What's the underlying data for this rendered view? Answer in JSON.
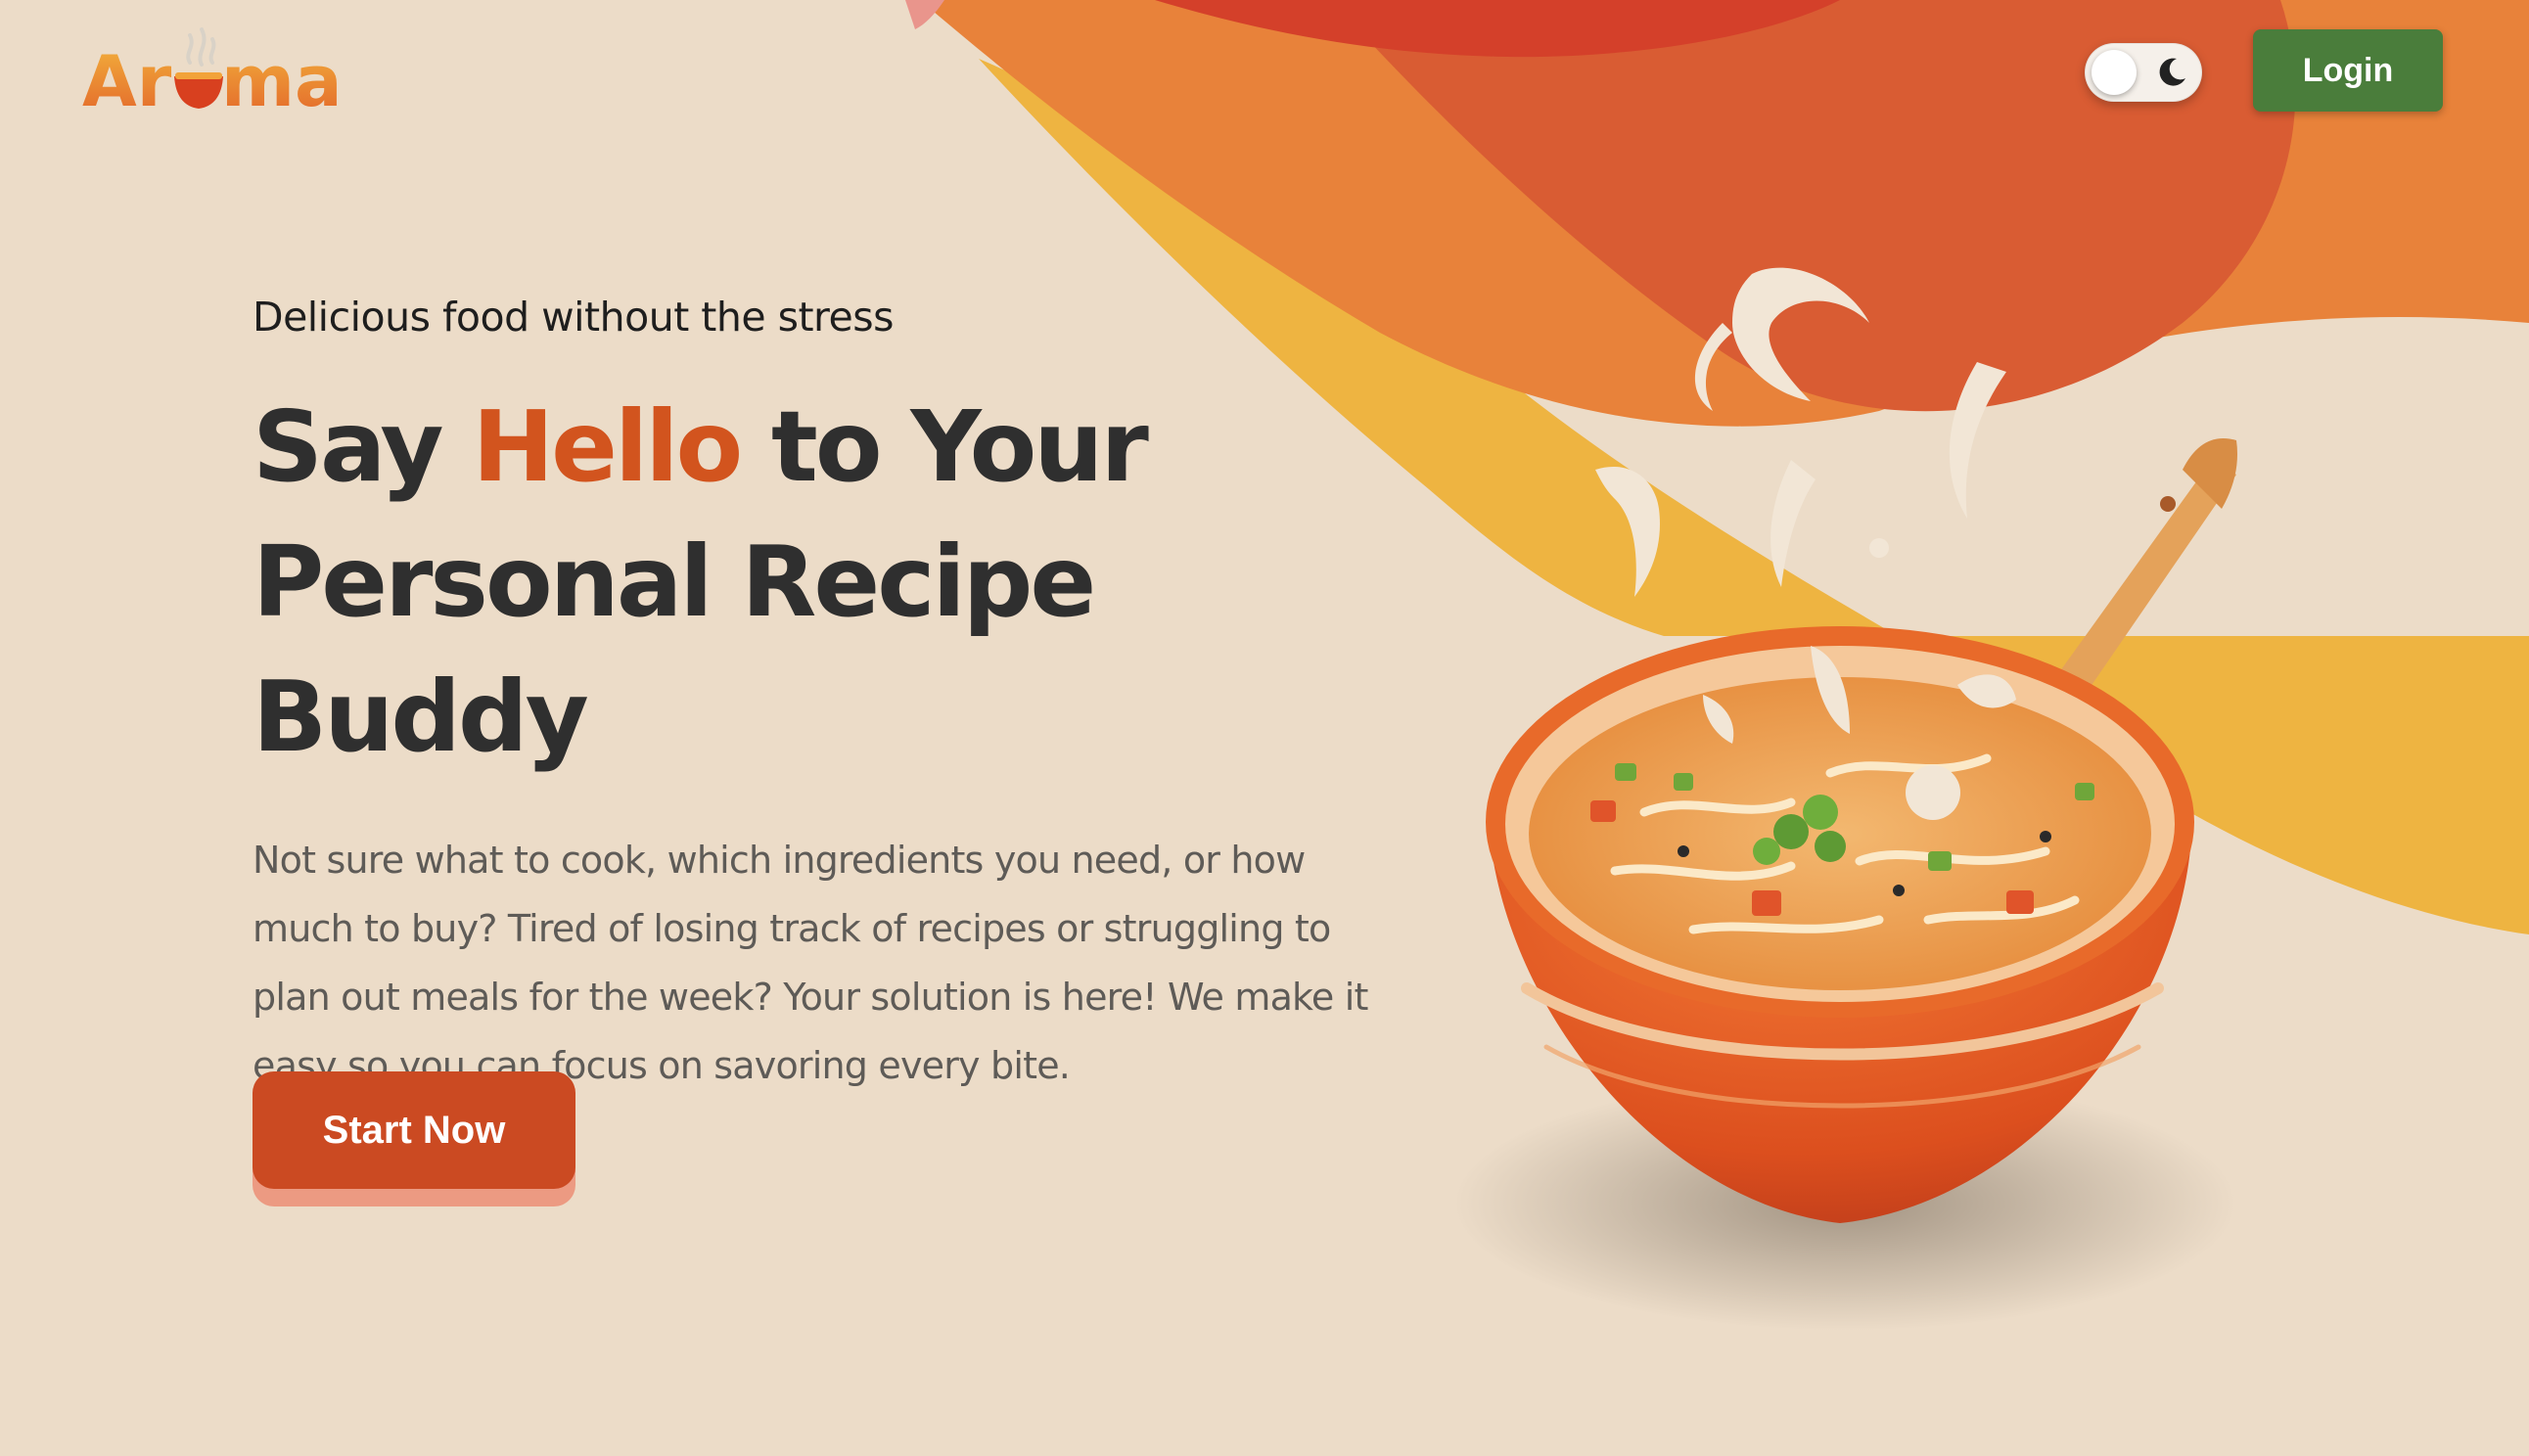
{
  "brand": {
    "name_part1": "Ar",
    "name_part2": "ma"
  },
  "header": {
    "theme_toggle_icon": "moon-icon",
    "login_label": "Login"
  },
  "hero": {
    "tagline": "Delicious food without the stress",
    "headline_line1_start": "Say ",
    "headline_highlight": "Hello",
    "headline_line1_end": " to Your",
    "headline_line2": "Personal Recipe Buddy",
    "intro": "Not sure what to cook, which ingredients you need, or how much to buy? Tired of losing track of recipes or struggling to plan out meals for the week? Your solution is here! We make it easy so you can focus on savoring every bite.",
    "cta_label": "Start Now"
  },
  "colors": {
    "background": "#ecdcc8",
    "accent": "#d2541e",
    "cta": "#cb4a22",
    "login": "#4a7d3b",
    "wave_yellow": "#eeb441",
    "wave_orange": "#e8823a",
    "wave_red": "#d95c33"
  }
}
